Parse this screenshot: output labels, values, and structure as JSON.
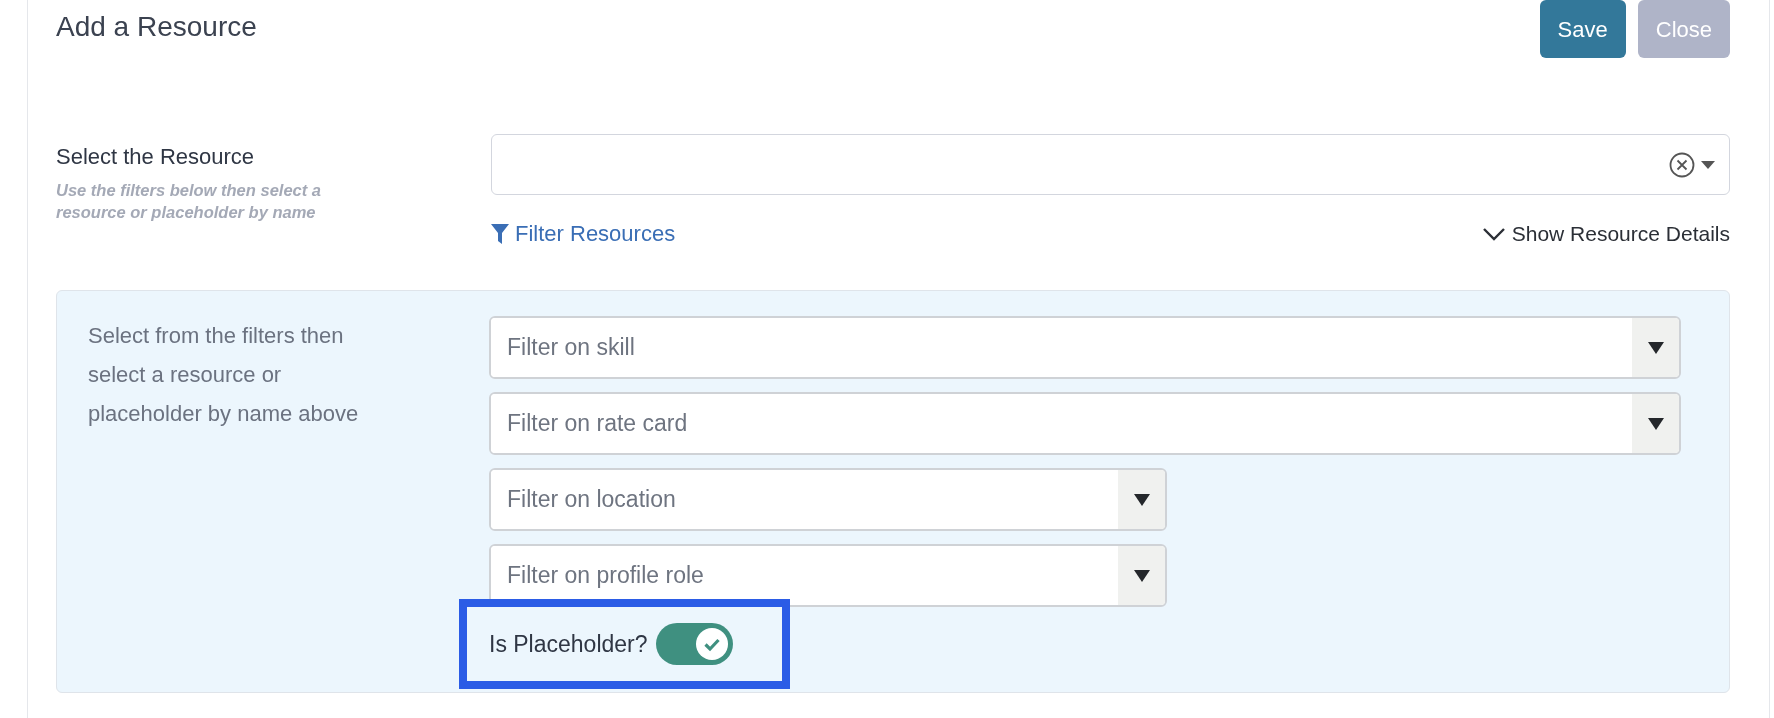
{
  "title": "Add a Resource",
  "buttons": [
    {
      "label": "Save",
      "disabled": false
    },
    {
      "label": "Close",
      "disabled": true
    }
  ],
  "resource": {
    "label": "Select the Resource",
    "hint": "Use the filters below then select a resource or placeholder by name",
    "filter_link": "Filter Resources",
    "details_link": "Show Resource Details"
  },
  "filter_panel": {
    "description": "Select from the filters then select a resource or placeholder by name above",
    "filters": [
      {
        "placeholder": "Filter on skill",
        "kind": "wide"
      },
      {
        "placeholder": "Filter on rate card",
        "kind": "wide"
      },
      {
        "placeholder": "Filter on location",
        "kind": "narrow"
      },
      {
        "placeholder": "Filter on profile role",
        "kind": "narrow"
      }
    ],
    "toggle": {
      "label": "Is Placeholder?",
      "on": true
    }
  }
}
